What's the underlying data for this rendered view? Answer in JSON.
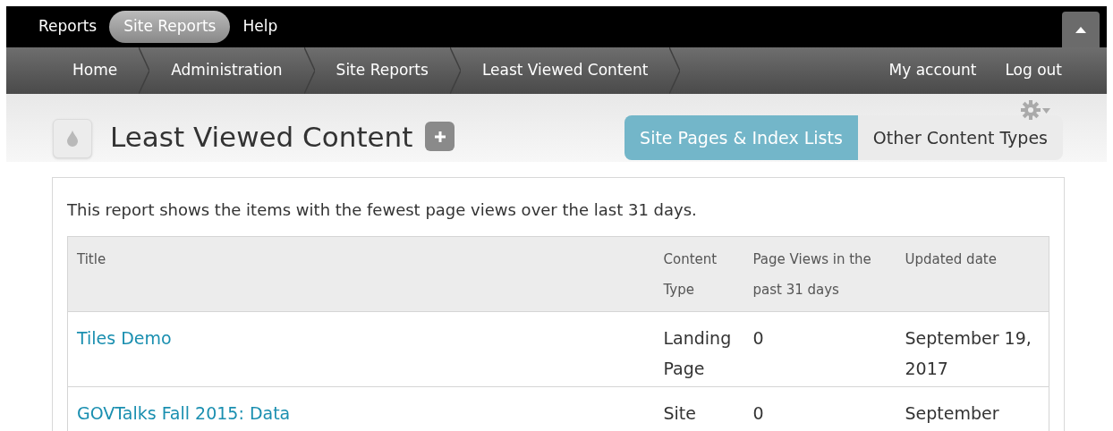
{
  "toolbar": {
    "items": [
      {
        "label": "Reports",
        "selected": false
      },
      {
        "label": "Site Reports",
        "selected": true
      },
      {
        "label": "Help",
        "selected": false
      }
    ]
  },
  "breadcrumb": [
    "Home",
    "Administration",
    "Site Reports",
    "Least Viewed Content"
  ],
  "user_links": [
    "My account",
    "Log out"
  ],
  "page": {
    "title": "Least Viewed Content"
  },
  "tabs": [
    {
      "label": "Site Pages & Index Lists",
      "selected": true
    },
    {
      "label": "Other Content Types",
      "selected": false
    }
  ],
  "description": "This report shows the items with the fewest page views over the last 31 days.",
  "table": {
    "columns": [
      "Title",
      "Content Type",
      "Page Views in the past 31 days",
      "Updated date"
    ],
    "rows": [
      {
        "title": "Tiles Demo",
        "content_type": "Landing Page",
        "page_views": "0",
        "updated": "September 19, 2017"
      },
      {
        "title": "GOVTalks Fall 2015: Data",
        "content_type": "Site",
        "page_views": "0",
        "updated": "September"
      }
    ]
  }
}
